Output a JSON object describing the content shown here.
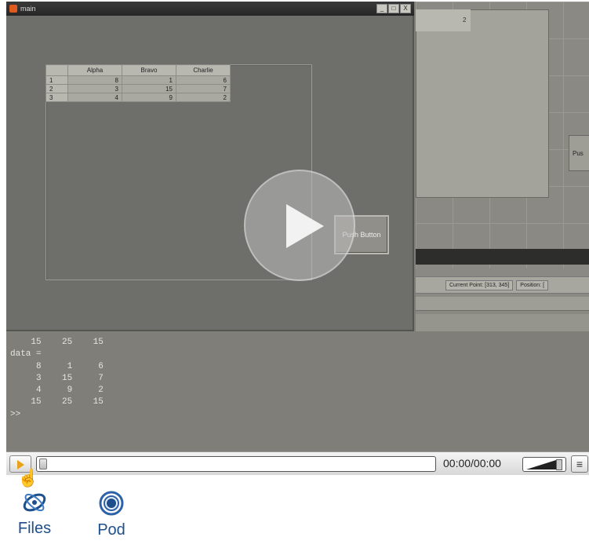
{
  "figure_window": {
    "title": "main",
    "win_buttons": [
      "_",
      "□",
      "X"
    ],
    "table": {
      "columns": [
        "Alpha",
        "Bravo",
        "Charlie"
      ],
      "rows": [
        {
          "label": "1",
          "values": [
            "8",
            "1",
            "6"
          ]
        },
        {
          "label": "2",
          "values": [
            "3",
            "15",
            "7"
          ]
        },
        {
          "label": "3",
          "values": [
            "4",
            "9",
            "2"
          ]
        }
      ]
    },
    "push_button_label": "Push Button"
  },
  "right_panel": {
    "field_value": "2",
    "push_button_label": "Pus",
    "status": {
      "current_point": "Current Point: [313, 345]",
      "position": "Position: ["
    }
  },
  "console": {
    "lines": [
      "    15    25    15",
      "data =",
      "     8     1     6",
      "     3    15     7",
      "     4     9     2",
      "    15    25    15",
      ">>"
    ]
  },
  "player": {
    "time": "00:00/00:00",
    "menu_icon": "hamburger-icon",
    "play_icon": "play-icon",
    "progress_fraction": 0
  },
  "bottom_links": {
    "files": "Files",
    "pod": "Pod"
  },
  "colors": {
    "play_accent": "#e8a21a",
    "link_blue": "#1d4f8a"
  }
}
